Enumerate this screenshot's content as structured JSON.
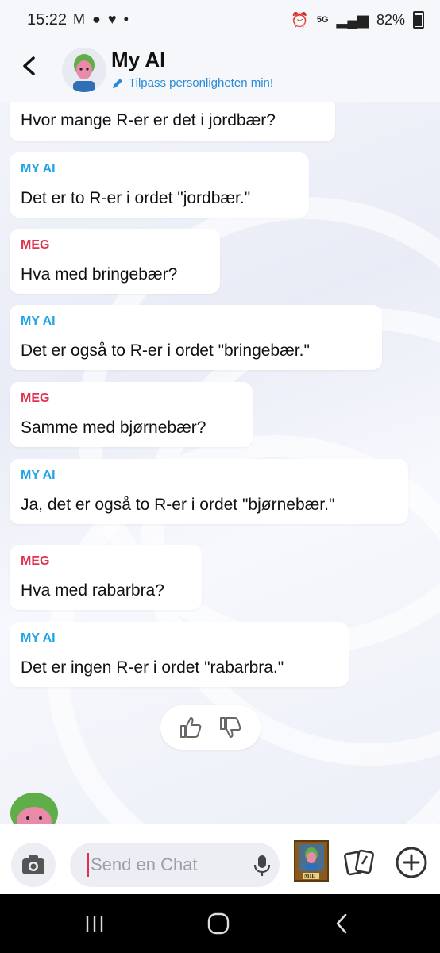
{
  "status_bar": {
    "time": "15:22",
    "notif_icons": [
      "gmail-icon",
      "chat-icon",
      "heart-icon",
      "dot-icon"
    ],
    "battery": "82%",
    "network": "5G"
  },
  "header": {
    "title": "My AI",
    "subtitle": "Tilpass personligheten min!"
  },
  "messages": [
    {
      "sender": "",
      "text": "Hvor mange R-er er det i jordbær?"
    },
    {
      "sender": "MY AI",
      "text": "Det er to R-er i ordet \"jordbær.\""
    },
    {
      "sender": "MEG",
      "text": "Hva med bringebær?"
    },
    {
      "sender": "MY AI",
      "text": "Det er også to R-er i ordet \"bringebær.\""
    },
    {
      "sender": "MEG",
      "text": "Samme med bjørnebær?"
    },
    {
      "sender": "MY AI",
      "text": "Ja, det er også to R-er i ordet \"bjørnebær.\""
    },
    {
      "sender": "MEG",
      "text": "Hva med rabarbra?"
    },
    {
      "sender": "MY AI",
      "text": "Det er ingen R-er i ordet \"rabarbra.\""
    }
  ],
  "input": {
    "placeholder": "Send en Chat"
  },
  "bitmoji_label": "MID",
  "colors": {
    "ai_label": "#20a4e6",
    "me_label": "#e0324f",
    "link": "#2b8ad6"
  }
}
